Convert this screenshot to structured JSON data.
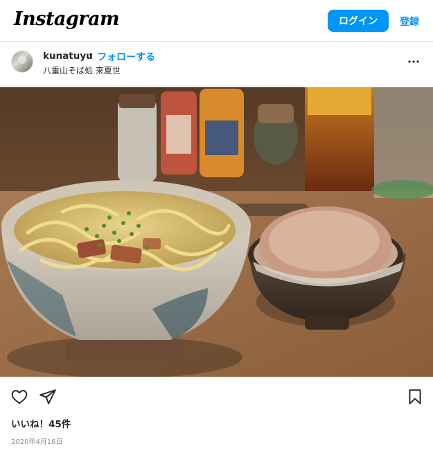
{
  "topnav": {
    "logo_text": "Instagram",
    "login_label": "ログイン",
    "signup_label": "登録"
  },
  "post": {
    "username": "kunatuyu",
    "separator": "•",
    "follow_label": "フォローする",
    "location": "八重山そば処 来夏世",
    "photo_icon": "food-photo",
    "likes_text": "いいね！45件",
    "date_text": "2020年4月16日"
  },
  "colors": {
    "accent": "#0095f6",
    "text": "#262626",
    "muted": "#8e8e8e",
    "border": "#dbdbdb"
  },
  "icons": {
    "more": "more-options-icon",
    "like": "heart-icon",
    "share": "paper-plane-icon",
    "save": "bookmark-icon"
  }
}
